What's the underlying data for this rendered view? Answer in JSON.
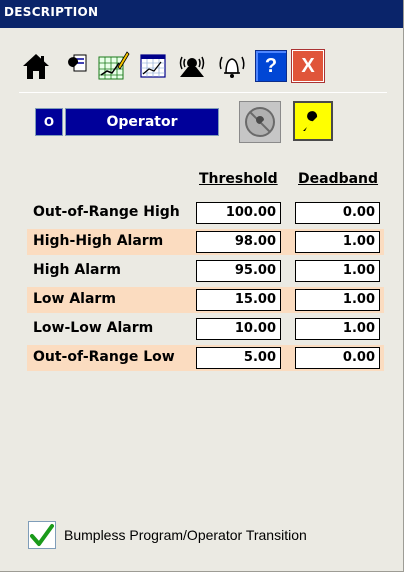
{
  "window": {
    "title": "DESCRIPTION"
  },
  "toolbar": {
    "icons": [
      "home-icon",
      "wrench-settings-icon",
      "trend-edit-icon",
      "trend-history-icon",
      "tuning-icon",
      "alarm-bell-icon",
      "help-icon",
      "close-icon"
    ],
    "help_label": "?",
    "close_label": "X"
  },
  "mode": {
    "indicator": "O",
    "label": "Operator",
    "indicator_color": "#00009a"
  },
  "table": {
    "headers": {
      "threshold": "Threshold",
      "deadband": "Deadband"
    },
    "rows": [
      {
        "label": "Out-of-Range High",
        "threshold": "100.00",
        "deadband": "0.00"
      },
      {
        "label": "High-High Alarm",
        "threshold": "98.00",
        "deadband": "1.00"
      },
      {
        "label": "High Alarm",
        "threshold": "95.00",
        "deadband": "1.00"
      },
      {
        "label": "Low Alarm",
        "threshold": "15.00",
        "deadband": "1.00"
      },
      {
        "label": "Low-Low Alarm",
        "threshold": "10.00",
        "deadband": "1.00"
      },
      {
        "label": "Out-of-Range Low",
        "threshold": "5.00",
        "deadband": "0.00"
      }
    ],
    "highlight_color": "#fbdcc0"
  },
  "options": {
    "bumpless_label": "Bumpless Program/Operator Transition",
    "bumpless_checked": true
  }
}
